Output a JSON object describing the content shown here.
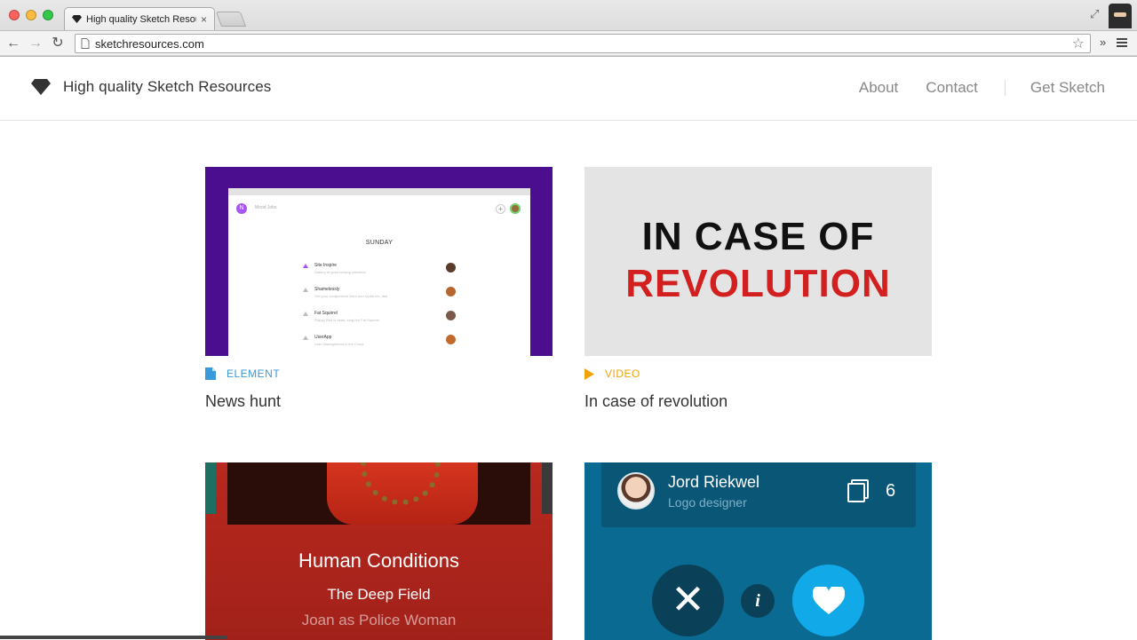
{
  "browser": {
    "tab_title": "High quality Sketch Resour",
    "tab_close": "×",
    "url": "sketchresources.com",
    "back_glyph": "←",
    "forward_glyph": "→",
    "reload_glyph": "↻",
    "star_glyph": "☆",
    "more_glyph": "»",
    "expand_glyph": "⤢"
  },
  "header": {
    "brand_title": "High quality Sketch Resources",
    "nav": {
      "about": "About",
      "contact": "Contact",
      "get_sketch": "Get Sketch"
    }
  },
  "cards": [
    {
      "category": "ELEMENT",
      "category_color": "#3a9ad9",
      "category_icon": "document-icon",
      "title": "News hunt",
      "thumb": {
        "logo": "N",
        "tabs": "Mood   Jobs",
        "plus": "+",
        "day": "SUNDAY",
        "rows": [
          {
            "title": "Site Inspire",
            "sub": "Gallery of good looking websites"
          },
          {
            "title": "Shamelessly",
            "sub": "Get your components fixed and styled etc, fast"
          },
          {
            "title": "Fat Squirrel",
            "sub": "Flappy Bird is dead, long live Fat Squirrel"
          },
          {
            "title": "UserApp",
            "sub": "User Management in the Cloud"
          }
        ]
      }
    },
    {
      "category": "VIDEO",
      "category_color": "#f0a30a",
      "category_icon": "play-icon",
      "title": "In case of revolution",
      "thumb": {
        "line1": "IN CASE OF",
        "line2": "REVOLUTION"
      }
    },
    {
      "thumb": {
        "title": "Human Conditions",
        "song": "The Deep Field",
        "artist": "Joan as Police Woman"
      }
    },
    {
      "thumb": {
        "name": "Jord Riekwel",
        "role": "Logo designer",
        "count": "6",
        "close_glyph": "✕",
        "info_glyph": "i"
      }
    }
  ]
}
